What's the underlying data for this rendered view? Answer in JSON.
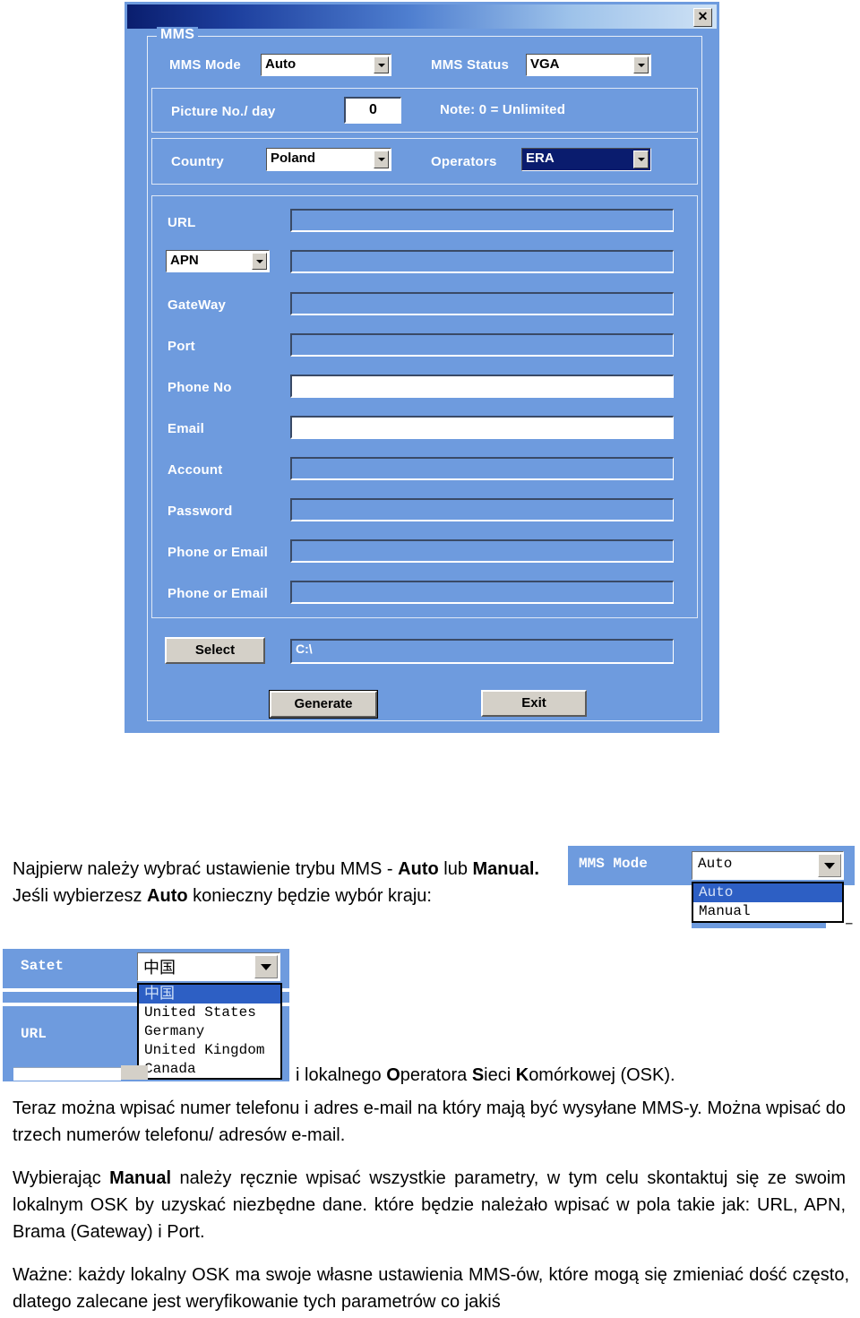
{
  "dialog": {
    "titlebar": {
      "close_label": "✕"
    },
    "group_label": "MMS",
    "rows": {
      "mms_mode_label": "MMS Mode",
      "mms_mode_value": "Auto",
      "mms_status_label": "MMS Status",
      "mms_status_value": "VGA",
      "picture_label": "Picture No./ day",
      "picture_value": "0",
      "note": "Note: 0 = Unlimited",
      "country_label": "Country",
      "country_value": "Poland",
      "operators_label": "Operators",
      "operators_value": "ERA"
    },
    "fields": [
      {
        "label": "URL",
        "value": "",
        "enabled": false
      },
      {
        "label": "APN",
        "value": "",
        "enabled": false
      },
      {
        "label": "GateWay",
        "value": "",
        "enabled": false
      },
      {
        "label": "Port",
        "value": "",
        "enabled": false
      },
      {
        "label": "Phone No",
        "value": "",
        "enabled": true
      },
      {
        "label": "Email",
        "value": "",
        "enabled": true
      },
      {
        "label": "Account",
        "value": "",
        "enabled": false
      },
      {
        "label": "Password",
        "value": "",
        "enabled": false
      },
      {
        "label": "Phone or Email",
        "value": "",
        "enabled": false
      },
      {
        "label": "Phone or Email",
        "value": "",
        "enabled": false
      }
    ],
    "apn_combo_value": "APN",
    "path": {
      "select_label": "Select",
      "value": "C:\\"
    },
    "buttons": {
      "generate": "Generate",
      "exit": "Exit"
    },
    "colors": {
      "dialog_bg": "#6e9bde",
      "title_dark": "#0a1e6e",
      "title_light": "#cfe2f5",
      "button_face": "#d4d0c8",
      "selected_combo": "#0a1c6e"
    }
  },
  "figure_mms_mode": {
    "label": "MMS Mode",
    "value": "Auto",
    "options": [
      "Auto",
      "Manual"
    ],
    "selected": "Auto"
  },
  "figure_country": {
    "label": "Satet",
    "label2": "URL",
    "value": "中国",
    "options": [
      "中国",
      "United States",
      "Germany",
      "United Kingdom",
      "Canada"
    ],
    "selected": "中国"
  },
  "prose": {
    "p1_a": "Najpierw należy wybrać ustawienie trybu MMS - ",
    "p1_b": "Auto",
    "p1_c": " lub ",
    "p1_d": "Manual.",
    "p1_e": " Jeśli wybierzesz ",
    "p1_f": "Auto",
    "p1_g": " konieczny będzie wybór kraju:",
    "p2_a": "i lokalnego ",
    "p2_b": "O",
    "p2_c": "peratora ",
    "p2_d": "S",
    "p2_e": "ieci ",
    "p2_f": "K",
    "p2_g": "omórkowej (OSK).",
    "p3": "Teraz można wpisać numer telefonu i adres e-mail na który mają być wysyłane MMS-y. Można wpisać do trzech numerów telefonu/ adresów e-mail.",
    "p4_a": "Wybierając ",
    "p4_b": "Manual",
    "p4_c": " należy ręcznie wpisać wszystkie parametry, w tym celu skontaktuj się ze swoim lokalnym OSK by uzyskać niezbędne dane. które będzie należało wpisać w pola takie jak: URL, APN, Brama (Gateway) i Port.",
    "p5": "Ważne: każdy lokalny OSK ma swoje własne ustawienia MMS-ów, które mogą się zmieniać dość często, dlatego zalecane jest weryfikowanie tych parametrów co jakiś"
  }
}
